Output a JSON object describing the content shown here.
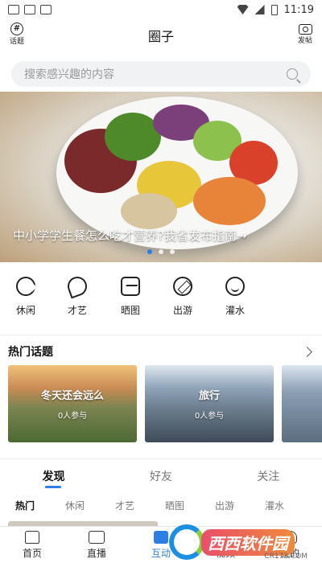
{
  "status_bar": {
    "time": "11:19"
  },
  "header": {
    "title": "圈子",
    "left_button": {
      "label": "话题",
      "icon": "hash-icon"
    },
    "right_button": {
      "label": "发帖",
      "icon": "camera-icon"
    }
  },
  "search": {
    "placeholder": "搜索感兴趣的内容",
    "icon": "search-icon"
  },
  "banner": {
    "caption": "中小学学生餐怎么吃才营养?我省发布指南→",
    "page_count": 3,
    "active_page": 1
  },
  "categories": [
    {
      "label": "休闲",
      "icon": "leisure-icon"
    },
    {
      "label": "才艺",
      "icon": "talent-icon"
    },
    {
      "label": "晒图",
      "icon": "photo-icon"
    },
    {
      "label": "出游",
      "icon": "travel-icon"
    },
    {
      "label": "灌水",
      "icon": "chat-icon"
    }
  ],
  "hot_topics": {
    "title": "热门话题",
    "items": [
      {
        "name": "冬天还会远么",
        "count": "0人参与"
      },
      {
        "name": "旅行",
        "count": "0人参与"
      },
      {
        "name": "",
        "count": ""
      }
    ]
  },
  "tabs": [
    {
      "label": "发现",
      "active": true
    },
    {
      "label": "好友",
      "active": false
    },
    {
      "label": "关注",
      "active": false
    }
  ],
  "sub_tabs": [
    {
      "label": "热门",
      "active": true
    },
    {
      "label": "休闲",
      "active": false
    },
    {
      "label": "才艺",
      "active": false
    },
    {
      "label": "晒图",
      "active": false
    },
    {
      "label": "出游",
      "active": false
    },
    {
      "label": "灌水",
      "active": false
    }
  ],
  "bottom_nav": [
    {
      "label": "首页",
      "icon": "home-icon",
      "active": false
    },
    {
      "label": "直播",
      "icon": "live-icon",
      "active": false
    },
    {
      "label": "互动",
      "icon": "interact-icon",
      "active": true
    },
    {
      "label": "视频",
      "icon": "video-icon",
      "active": false
    },
    {
      "label": "我的",
      "icon": "mine-icon",
      "active": false
    }
  ],
  "watermark": {
    "text": "西西软件园",
    "domain": "CR173.COM"
  },
  "colors": {
    "accent": "#2d7fe6",
    "search_bg": "#f1f2f4"
  }
}
